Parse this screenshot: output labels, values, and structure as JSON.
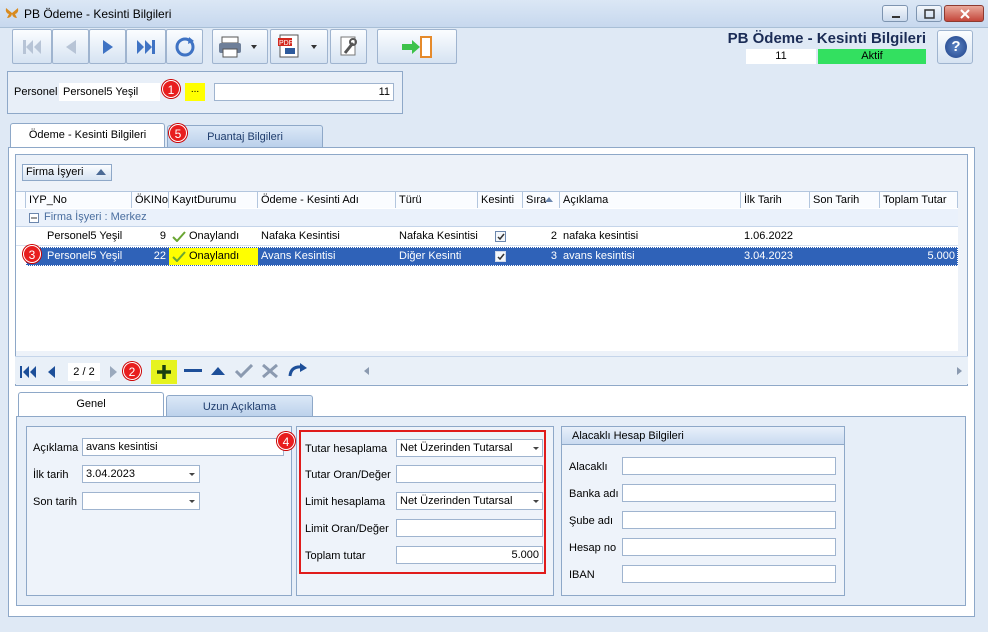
{
  "window": {
    "title": "PB Ödeme - Kesinti Bilgileri"
  },
  "header": {
    "title": "PB Ödeme - Kesinti Bilgileri",
    "record_no": "11",
    "status": "Aktif"
  },
  "personel": {
    "label": "Personel",
    "value": "Personel5 Yeşil",
    "picker_label": "...",
    "code": "11"
  },
  "tabs": [
    {
      "label": "Ödeme - Kesinti Bilgileri"
    },
    {
      "label": "Puantaj Bilgileri"
    }
  ],
  "group_by": {
    "label": "Firma İşyeri"
  },
  "grid": {
    "columns": [
      "IYP_No",
      "ÖKINo",
      "KayıtDurumu",
      "Ödeme - Kesinti Adı",
      "Türü",
      "Kesinti",
      "Sıra",
      "Açıklama",
      "İlk Tarih",
      "Son Tarih",
      "Toplam Tutar"
    ],
    "group_row": "Firma İşyeri : Merkez",
    "rows": [
      {
        "iyp_no": "Personel5 Yeşil",
        "oki_no": "9",
        "kayit_durumu": "Onaylandı",
        "ad": "Nafaka Kesintisi",
        "turu": "Nafaka Kesintisi",
        "kesinti": true,
        "sira": "2",
        "aciklama": "nafaka kesintisi",
        "ilk_tarih": "1.06.2022",
        "son_tarih": "",
        "toplam_tutar": ""
      },
      {
        "iyp_no": "Personel5 Yeşil",
        "oki_no": "22",
        "kayit_durumu": "Onaylandı",
        "ad": "Avans Kesintisi",
        "turu": "Diğer Kesinti",
        "kesinti": true,
        "sira": "3",
        "aciklama": "avans kesintisi",
        "ilk_tarih": "3.04.2023",
        "son_tarih": "",
        "toplam_tutar": "5.000"
      }
    ]
  },
  "navigator": {
    "page": "2 / 2"
  },
  "badges": {
    "b1": "1",
    "b2": "2",
    "b3": "3",
    "b4": "4",
    "b5": "5"
  },
  "detail_tabs": [
    {
      "label": "Genel"
    },
    {
      "label": "Uzun Açıklama"
    }
  ],
  "genel": {
    "aciklama_label": "Açıklama",
    "aciklama_value": "avans kesintisi",
    "ilk_tarih_label": "İlk tarih",
    "ilk_tarih_value": "3.04.2023",
    "son_tarih_label": "Son tarih",
    "son_tarih_value": ""
  },
  "tutar": {
    "tutar_hesaplama_label": "Tutar hesaplama",
    "tutar_hesaplama_value": "Net Üzerinden Tutarsal",
    "tutar_oran_label": "Tutar Oran/Değer",
    "tutar_oran_value": "",
    "limit_hesaplama_label": "Limit hesaplama",
    "limit_hesaplama_value": "Net Üzerinden Tutarsal",
    "limit_oran_label": "Limit Oran/Değer",
    "limit_oran_value": "",
    "toplam_tutar_label": "Toplam tutar",
    "toplam_tutar_value": "5.000"
  },
  "alacakli": {
    "title": "Alacaklı Hesap Bilgileri",
    "alacakli_label": "Alacaklı",
    "banka_label": "Banka adı",
    "sube_label": "Şube adı",
    "hesap_label": "Hesap no",
    "iban_label": "IBAN"
  },
  "colors": {
    "accent": "#2f62b8",
    "selected_row": "#2f62b8",
    "status_green": "#33e060",
    "highlight_red": "#e81e1e",
    "highlight_yellow": "#ffff00"
  }
}
